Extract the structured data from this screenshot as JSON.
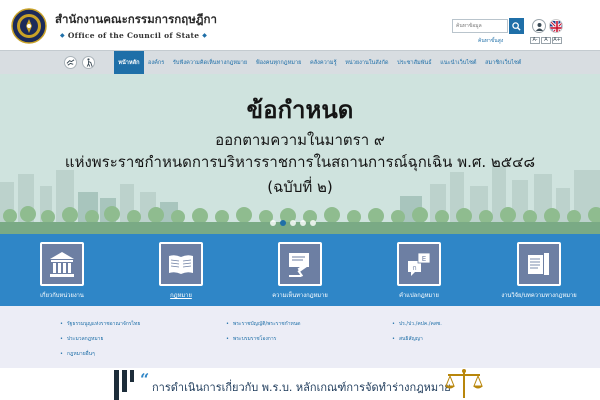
{
  "header": {
    "org_name_th": "สำนักงานคณะกรรมการกฤษฎีกา",
    "org_name_en": "Office of the Council of State",
    "search_placeholder": "ค้นหาข้อมูล",
    "advanced_search": "ค้นหาขั้นสูง",
    "font_sizes": [
      "A-",
      "A",
      "A+"
    ]
  },
  "nav": {
    "items": [
      {
        "label": "หน้าหลัก",
        "active": true
      },
      {
        "label": "องค์กร"
      },
      {
        "label": "รับฟังความคิดเห็นทางกฎหมาย"
      },
      {
        "label": "ฟ้องคนทุกกฎหมาย"
      },
      {
        "label": "คลังความรู้"
      },
      {
        "label": "หน่วยงานในสังกัด"
      },
      {
        "label": "ประชาสัมพันธ์"
      },
      {
        "label": "แนะนำเว็บไซต์"
      },
      {
        "label": "สมาชิกเว็บไซต์"
      }
    ]
  },
  "banner": {
    "title": "ข้อกำหนด",
    "line2": "ออกตามความในมาตรา ๙",
    "line3": "แห่งพระราชกำหนดการบริหารราชการในสถานการณ์ฉุกเฉิน พ.ศ. ๒๕๔๘",
    "line4": "(ฉบับที่ ๒)",
    "slide_count": 5,
    "active_slide": 1
  },
  "services": [
    {
      "label": "เกี่ยวกับหน่วยงาน",
      "icon": "building-icon"
    },
    {
      "label": "กฎหมาย",
      "icon": "book-icon",
      "active": true
    },
    {
      "label": "ความเห็นทางกฎหมาย",
      "icon": "gavel-icon"
    },
    {
      "label": "คำแปลกฎหมาย",
      "icon": "translate-icon"
    },
    {
      "label": "งานวิจัย/บทความทางกฎหมาย",
      "icon": "documents-icon"
    }
  ],
  "sublinks": {
    "col1": [
      "รัฐธรรมนูญแห่งราชอาณาจักรไทย",
      "ประมวลกฎหมาย",
      "กฎหมายอื่นๆ"
    ],
    "col2": [
      "พระราชบัญญัติ/พระราชกำหนด",
      "พระบรมราชโองการ"
    ],
    "col3": [
      "ปร./ปว./คปค./คสช.",
      "สนธิสัญญา"
    ]
  },
  "bottom": {
    "text": "การดำเนินการเกี่ยวกับ พ.ร.บ. หลักเกณฑ์การจัดทำร่างกฎหมาย"
  },
  "colors": {
    "primary": "#1f6fa8",
    "services_bg": "#2f86c7",
    "banner_bg": "#cfe3de",
    "sublinks_bg": "#ecedf6",
    "nav_bg": "#d8dde1"
  }
}
